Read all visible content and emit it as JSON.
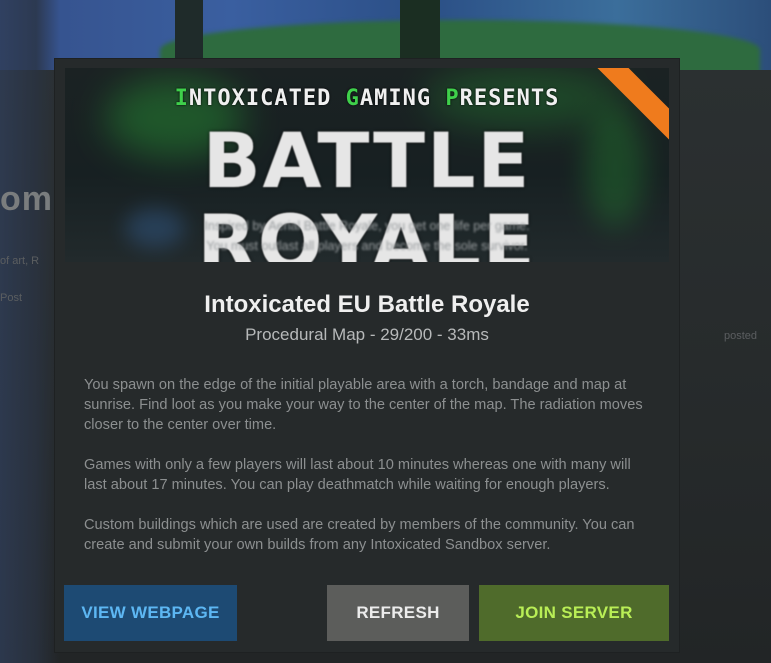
{
  "background": {
    "partial_heading": "omm",
    "partial_text_1": "of art, R",
    "partial_text_2": "Post",
    "partial_text_right": "posted"
  },
  "banner": {
    "kicker_parts": [
      "I",
      "NTOXICATED ",
      "G",
      "AMING ",
      "P",
      "RESENTS"
    ],
    "title": "BATTLE ROYALE",
    "subtitle_line1": "Inspired by Aerial Battle Royale, you get one life per game.",
    "subtitle_line2": "You must outlast all players and become the sole survivor."
  },
  "server": {
    "name": "Intoxicated EU Battle Royale",
    "meta": "Procedural Map - 29/200 - 33ms"
  },
  "description": [
    "You spawn on the edge of the initial playable area with a torch, bandage and map at sunrise. Find loot as you make your way to the center of the map. The radiation moves closer to the center over time.",
    "Games with only a few players will last about 10 minutes whereas one with many will last about 17 minutes. You can play deathmatch while waiting for enough players.",
    "Custom buildings which are used are created by members of the community. You can create and submit your own builds from any Intoxicated Sandbox server."
  ],
  "buttons": {
    "view_webpage": "VIEW WEBPAGE",
    "refresh": "REFRESH",
    "join_server": "JOIN SERVER"
  },
  "colors": {
    "webpage_bg": "#1d4a73",
    "webpage_text": "#5db7f3",
    "refresh_bg": "#5c5d5b",
    "join_bg": "#4f6b2b",
    "join_text": "#b9ee56",
    "accent_green": "#3fd04b",
    "ribbon_orange": "#ef7b1d"
  }
}
